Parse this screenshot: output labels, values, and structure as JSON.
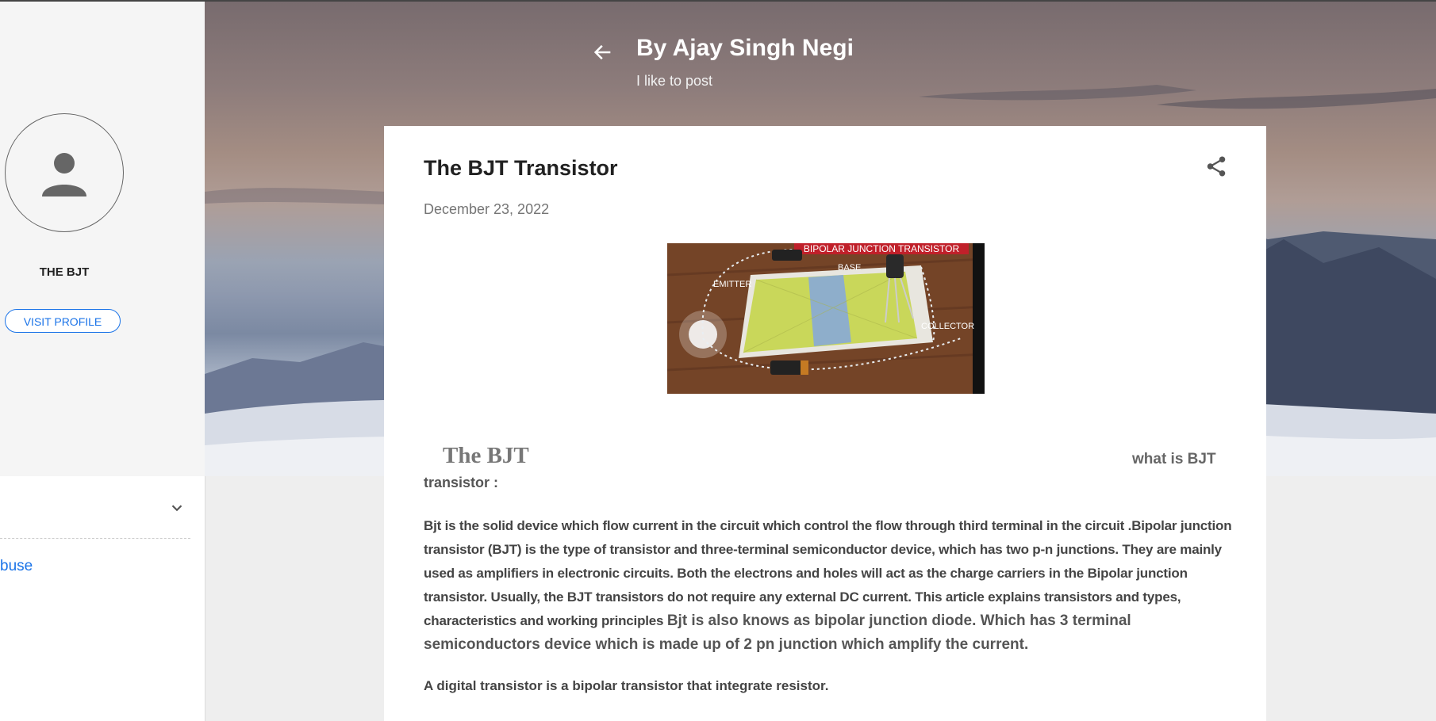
{
  "header": {
    "title": "By Ajay Singh Negi",
    "description": "I like to post",
    "back_icon": "arrow-back-icon",
    "search_icon": "search-icon"
  },
  "sidebar": {
    "profile_name": "THE BJT",
    "visit_profile": "VISIT PROFILE",
    "expand_icon": "chevron-down-icon",
    "link_text": "buse"
  },
  "post": {
    "title": "The BJT Transistor",
    "date": "December 23, 2022",
    "share_icon": "share-icon",
    "image": {
      "banner": "BIPOLAR JUNCTION TRANSISTOR",
      "label_base": "BASE",
      "label_emitter": "EMITTER",
      "label_collector": "COLLECTOR"
    },
    "heading_main": "The BJT",
    "heading_right": "what is BJT",
    "heading_line2": "transistor  :",
    "paragraph_part1": "Bjt is the solid  device which flow current   in the circuit which control  the flow through third terminal  in the circuit  .Bipolar junction transistor (BJT) is the type of transistor and three-terminal semiconductor device, which has two p-n junctions. They are mainly used as amplifiers in electronic circuits. Both the electrons and holes will act as the charge carriers in the Bipolar junction transistor. Usually, the BJT transistors do not require any external DC current. This article explains transistors and types, characteristics and working principles ",
    "paragraph_part2": "Bjt is also knows as bipolar junction diode. Which has 3 terminal semiconductors device which is made up of 2 pn junction which amplify the current.",
    "paragraph2": "A digital  transistor is a bipolar transistor that  integrate resistor."
  },
  "colors": {
    "accent": "#1a73e8",
    "card": "#ffffff",
    "page_bg": "#eeeeee"
  }
}
